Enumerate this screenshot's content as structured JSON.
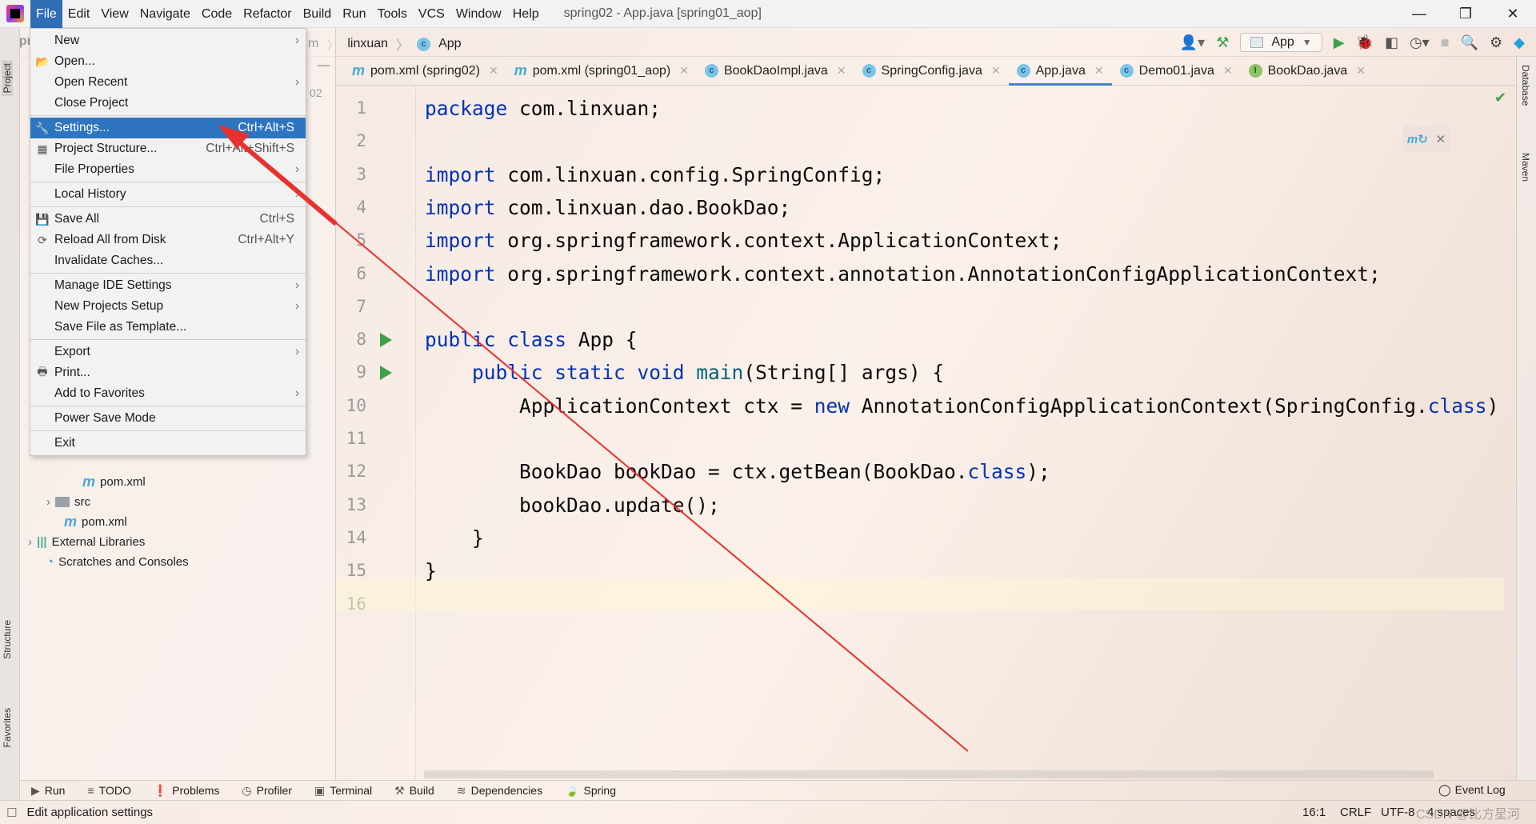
{
  "window": {
    "title": "spring02 - App.java [spring01_aop]",
    "minimize": "—",
    "restore": "❐",
    "close": "✕"
  },
  "menubar": [
    "File",
    "Edit",
    "View",
    "Navigate",
    "Code",
    "Refactor",
    "Build",
    "Run",
    "Tools",
    "VCS",
    "Window",
    "Help"
  ],
  "navbar": {
    "project_stub": "spr",
    "breadcrumb": [
      "m",
      "linxuan",
      "App"
    ],
    "run_config": "App"
  },
  "file_menu": [
    {
      "label": "New",
      "submenu": true
    },
    {
      "label": "Open...",
      "icon": "folder-open-icon"
    },
    {
      "label": "Open Recent",
      "submenu": true
    },
    {
      "label": "Close Project",
      "sep_after": true
    },
    {
      "label": "Settings...",
      "shortcut": "Ctrl+Alt+S",
      "icon": "wrench-icon",
      "highlighted": true
    },
    {
      "label": "Project Structure...",
      "shortcut": "Ctrl+Alt+Shift+S",
      "icon": "project-structure-icon"
    },
    {
      "label": "File Properties",
      "submenu": true,
      "sep_after": true
    },
    {
      "label": "Local History",
      "submenu": true,
      "sep_after": true
    },
    {
      "label": "Save All",
      "shortcut": "Ctrl+S",
      "icon": "save-icon"
    },
    {
      "label": "Reload All from Disk",
      "shortcut": "Ctrl+Alt+Y",
      "icon": "reload-icon"
    },
    {
      "label": "Invalidate Caches...",
      "sep_after": true
    },
    {
      "label": "Manage IDE Settings",
      "submenu": true
    },
    {
      "label": "New Projects Setup",
      "submenu": true
    },
    {
      "label": "Save File as Template...",
      "sep_after": true
    },
    {
      "label": "Export",
      "submenu": true
    },
    {
      "label": "Print...",
      "icon": "print-icon"
    },
    {
      "label": "Add to Favorites",
      "submenu": true,
      "sep_after": true
    },
    {
      "label": "Power Save Mode",
      "sep_after": true
    },
    {
      "label": "Exit"
    }
  ],
  "project_tree": [
    {
      "label": "pom.xml",
      "type": "maven"
    },
    {
      "label": "src",
      "type": "folder",
      "expandable": true
    },
    {
      "label": "pom.xml",
      "type": "maven"
    },
    {
      "label": "External Libraries",
      "type": "libraries",
      "expandable": true
    },
    {
      "label": "Scratches and Consoles",
      "type": "scratches"
    }
  ],
  "gutter_stub": "02",
  "tabs": [
    {
      "label": "pom.xml (spring02)",
      "type": "maven"
    },
    {
      "label": "pom.xml (spring01_aop)",
      "type": "maven"
    },
    {
      "label": "BookDaoImpl.java",
      "type": "class"
    },
    {
      "label": "SpringConfig.java",
      "type": "class"
    },
    {
      "label": "App.java",
      "type": "class",
      "active": true
    },
    {
      "label": "Demo01.java",
      "type": "class-run"
    },
    {
      "label": "BookDao.java",
      "type": "interface"
    }
  ],
  "code": [
    [
      [
        "package",
        "kw"
      ],
      [
        " com.linxuan;",
        ""
      ]
    ],
    [],
    [
      [
        "import",
        "kw"
      ],
      [
        " com.linxuan.config.SpringConfig;",
        ""
      ]
    ],
    [
      [
        "import",
        "kw"
      ],
      [
        " com.linxuan.dao.BookDao;",
        ""
      ]
    ],
    [
      [
        "import",
        "kw"
      ],
      [
        " org.springframework.context.ApplicationContext;",
        ""
      ]
    ],
    [
      [
        "import",
        "kw"
      ],
      [
        " org.springframework.context.annotation.AnnotationConfigApplicationContext;",
        ""
      ]
    ],
    [],
    [
      [
        "public class",
        "kw"
      ],
      [
        " App {",
        ""
      ]
    ],
    [
      [
        "    ",
        ""
      ],
      [
        "public static void",
        "kw"
      ],
      [
        " ",
        ""
      ],
      [
        "main",
        "fn"
      ],
      [
        "(String[] args) {",
        ""
      ]
    ],
    [
      [
        "        ApplicationContext ctx = ",
        ""
      ],
      [
        "new",
        "kw"
      ],
      [
        " AnnotationConfigApplicationContext(SpringConfig.",
        ""
      ],
      [
        "class",
        "kw"
      ],
      [
        ")",
        ""
      ]
    ],
    [],
    [
      [
        "        BookDao bookDao = ctx.getBean(BookDao.",
        ""
      ],
      [
        "class",
        "kw"
      ],
      [
        ");",
        ""
      ]
    ],
    [
      [
        "        bookDao.update();",
        ""
      ]
    ],
    [
      [
        "    }",
        ""
      ]
    ],
    [
      [
        "}",
        ""
      ]
    ],
    []
  ],
  "line_numbers": [
    "1",
    "2",
    "3",
    "4",
    "5",
    "6",
    "7",
    "8",
    "9",
    "10",
    "11",
    "12",
    "13",
    "14",
    "15",
    "16"
  ],
  "right_stripe": [
    "Database",
    "Maven"
  ],
  "left_stripe": [
    "Project",
    "Structure",
    "Favorites"
  ],
  "bottom_tools": [
    "Run",
    "TODO",
    "Problems",
    "Profiler",
    "Terminal",
    "Build",
    "Dependencies",
    "Spring"
  ],
  "event_log": "Event Log",
  "status": {
    "message": "Edit application settings",
    "position": "16:1",
    "line_ending": "CRLF",
    "encoding": "UTF-8",
    "indent": "4 spaces"
  },
  "watermark": "CSDN @比方星河",
  "colors": {
    "menu_highlight": "#2f74c0",
    "keyword": "#0033b3",
    "method": "#00627a",
    "arrow": "#e8322f"
  }
}
